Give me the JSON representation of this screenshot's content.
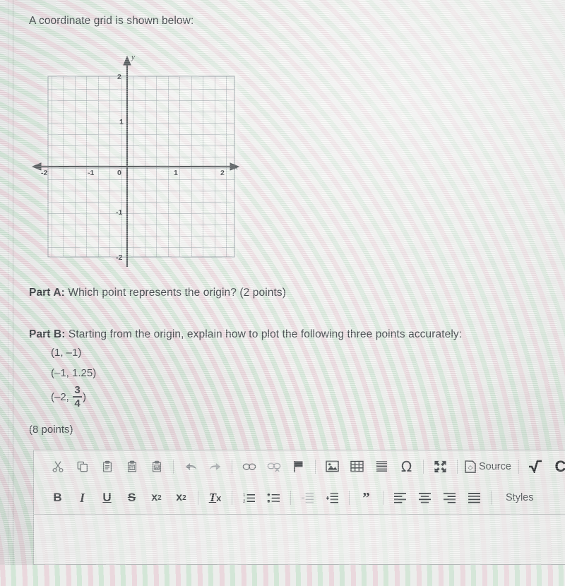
{
  "prompt": "A coordinate grid is shown below:",
  "graph": {
    "x_axis_label": "x",
    "y_axis_label": "y",
    "x_ticks": [
      "-2",
      "-1",
      "0",
      "1",
      "2"
    ],
    "y_ticks": [
      "2",
      "1",
      "-1",
      "-2"
    ],
    "origin_label": "0",
    "minor_per_unit": 4,
    "x_range": [
      -2,
      2
    ],
    "y_range": [
      -2,
      2
    ],
    "grid_color": "#8e9aa0",
    "axis_color": "#55595c"
  },
  "parts": {
    "a_label": "Part A:",
    "a_text": " Which point represents the origin? (2 points)",
    "b_label": "Part B:",
    "b_text": " Starting from the origin, explain how to plot the following three points accurately:"
  },
  "points": {
    "p1": "(1, –1)",
    "p2": "(–1, 1.25)",
    "p3_prefix": "(–2, ",
    "p3_num": "3",
    "p3_den": "4",
    "p3_suffix": ")"
  },
  "points_value": "(8 points)",
  "editor": {
    "toolbar_row1": [
      {
        "name": "cut-icon",
        "label": "Cut"
      },
      {
        "name": "copy-icon",
        "label": "Copy"
      },
      {
        "name": "paste-icon",
        "label": "Paste"
      },
      {
        "name": "paste-as-text-icon",
        "label": "Paste as plain text"
      },
      {
        "name": "paste-from-word-icon",
        "label": "Paste from Word"
      },
      {
        "name": "undo-icon",
        "label": "Undo"
      },
      {
        "name": "redo-icon",
        "label": "Redo"
      },
      {
        "name": "link-icon",
        "label": "Link"
      },
      {
        "name": "unlink-icon",
        "label": "Unlink"
      },
      {
        "name": "anchor-flag-icon",
        "label": "Anchor"
      },
      {
        "name": "image-icon",
        "label": "Image"
      },
      {
        "name": "table-icon",
        "label": "Table"
      },
      {
        "name": "horizontal-rule-icon",
        "label": "Horizontal Line"
      },
      {
        "name": "special-character-icon",
        "label": "Ω"
      },
      {
        "name": "maximize-icon",
        "label": "Maximize"
      },
      {
        "name": "source-icon",
        "label": "Source"
      },
      {
        "name": "square-root-icon",
        "label": "Square root"
      },
      {
        "name": "chemistry-icon",
        "label": "C"
      }
    ],
    "source_label": "Source",
    "toolbar_row2": [
      {
        "name": "bold-icon",
        "label": "B"
      },
      {
        "name": "italic-icon",
        "label": "I"
      },
      {
        "name": "underline-icon",
        "label": "U"
      },
      {
        "name": "strikethrough-icon",
        "label": "S"
      },
      {
        "name": "subscript-icon",
        "label": "x"
      },
      {
        "name": "superscript-icon",
        "label": "x"
      },
      {
        "name": "remove-format-icon",
        "label": "Tx"
      },
      {
        "name": "numbered-list-icon",
        "label": "Insert/Remove Numbered List"
      },
      {
        "name": "bulleted-list-icon",
        "label": "Insert/Remove Bulleted List"
      },
      {
        "name": "outdent-icon",
        "label": "Decrease Indent"
      },
      {
        "name": "indent-icon",
        "label": "Increase Indent"
      },
      {
        "name": "blockquote-icon",
        "label": "Block Quote"
      },
      {
        "name": "align-left-icon",
        "label": "Align Left"
      },
      {
        "name": "align-center-icon",
        "label": "Center"
      },
      {
        "name": "align-right-icon",
        "label": "Align Right"
      },
      {
        "name": "justify-icon",
        "label": "Justify"
      }
    ],
    "styles_label": "Styles",
    "styles_caret": "▼"
  }
}
